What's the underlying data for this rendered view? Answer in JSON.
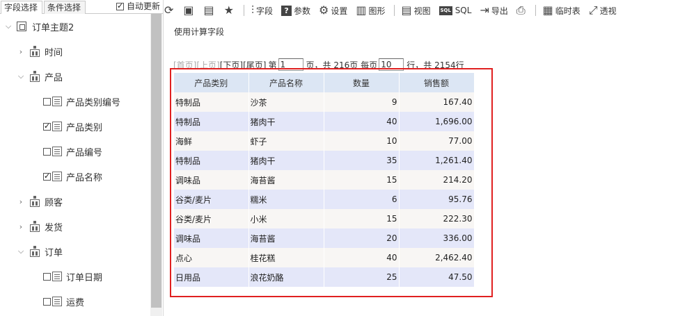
{
  "left_panel": {
    "tabs": [
      "字段选择",
      "条件选择"
    ],
    "auto_update": {
      "label": "自动更新",
      "checked": true
    },
    "root": "订单主题2",
    "tree": [
      {
        "label": "时间",
        "type": "folder",
        "expanded": false
      },
      {
        "label": "产品",
        "type": "folder",
        "expanded": true
      },
      {
        "label": "产品类别编号",
        "type": "field",
        "checked": false
      },
      {
        "label": "产品类别",
        "type": "field",
        "checked": true
      },
      {
        "label": "产品编号",
        "type": "field",
        "checked": false
      },
      {
        "label": "产品名称",
        "type": "field",
        "checked": true
      },
      {
        "label": "顾客",
        "type": "folder",
        "expanded": false
      },
      {
        "label": "发货",
        "type": "folder",
        "expanded": false
      },
      {
        "label": "订单",
        "type": "folder",
        "expanded": true
      },
      {
        "label": "订单日期",
        "type": "field",
        "checked": false
      },
      {
        "label": "运费",
        "type": "field",
        "checked": false
      }
    ]
  },
  "toolbar": {
    "items": [
      {
        "icon": "refresh-icon",
        "label": ""
      },
      {
        "icon": "save-icon",
        "label": ""
      },
      {
        "icon": "save-as-icon",
        "label": ""
      },
      {
        "icon": "star-icon",
        "label": ""
      },
      {
        "icon": "field-icon",
        "label": "字段"
      },
      {
        "icon": "param-icon",
        "label": "参数"
      },
      {
        "icon": "gear-icon",
        "label": "设置"
      },
      {
        "icon": "chart-icon",
        "label": "图形"
      },
      {
        "icon": "view-icon",
        "label": "视图"
      },
      {
        "icon": "sql-icon",
        "label": "SQL"
      },
      {
        "icon": "export-icon",
        "label": "导出"
      },
      {
        "icon": "print-icon",
        "label": ""
      },
      {
        "icon": "temp-table-icon",
        "label": "临时表"
      },
      {
        "icon": "pivot-icon",
        "label": "透视"
      }
    ]
  },
  "calc_field_link": "使用计算字段",
  "pager": {
    "first": "[首页]",
    "prev": "[上页]",
    "next": "[下页]",
    "last": "[尾页]",
    "page_prefix": "第",
    "page": "1",
    "total_pages_text": "页，共 216页",
    "per_page_prefix": "每页",
    "per_page": "10",
    "total_rows_text": "行，共 2154行"
  },
  "table": {
    "headers": [
      "产品类别",
      "产品名称",
      "数量",
      "销售额"
    ],
    "rows": [
      [
        "特制品",
        "沙茶",
        "9",
        "167.40"
      ],
      [
        "特制品",
        "猪肉干",
        "40",
        "1,696.00"
      ],
      [
        "海鲜",
        "虾子",
        "10",
        "77.00"
      ],
      [
        "特制品",
        "猪肉干",
        "35",
        "1,261.40"
      ],
      [
        "调味品",
        "海苔酱",
        "15",
        "214.20"
      ],
      [
        "谷类/麦片",
        "糯米",
        "6",
        "95.76"
      ],
      [
        "谷类/麦片",
        "小米",
        "15",
        "222.30"
      ],
      [
        "调味品",
        "海苔酱",
        "20",
        "336.00"
      ],
      [
        "点心",
        "桂花糕",
        "40",
        "2,462.40"
      ],
      [
        "日用品",
        "浪花奶酪",
        "25",
        "47.50"
      ]
    ]
  },
  "colors": {
    "header_bg": "#dce6f4",
    "row_odd": "#f8f6f4",
    "row_even": "#e4e7f9",
    "highlight_frame": "#e02020"
  }
}
